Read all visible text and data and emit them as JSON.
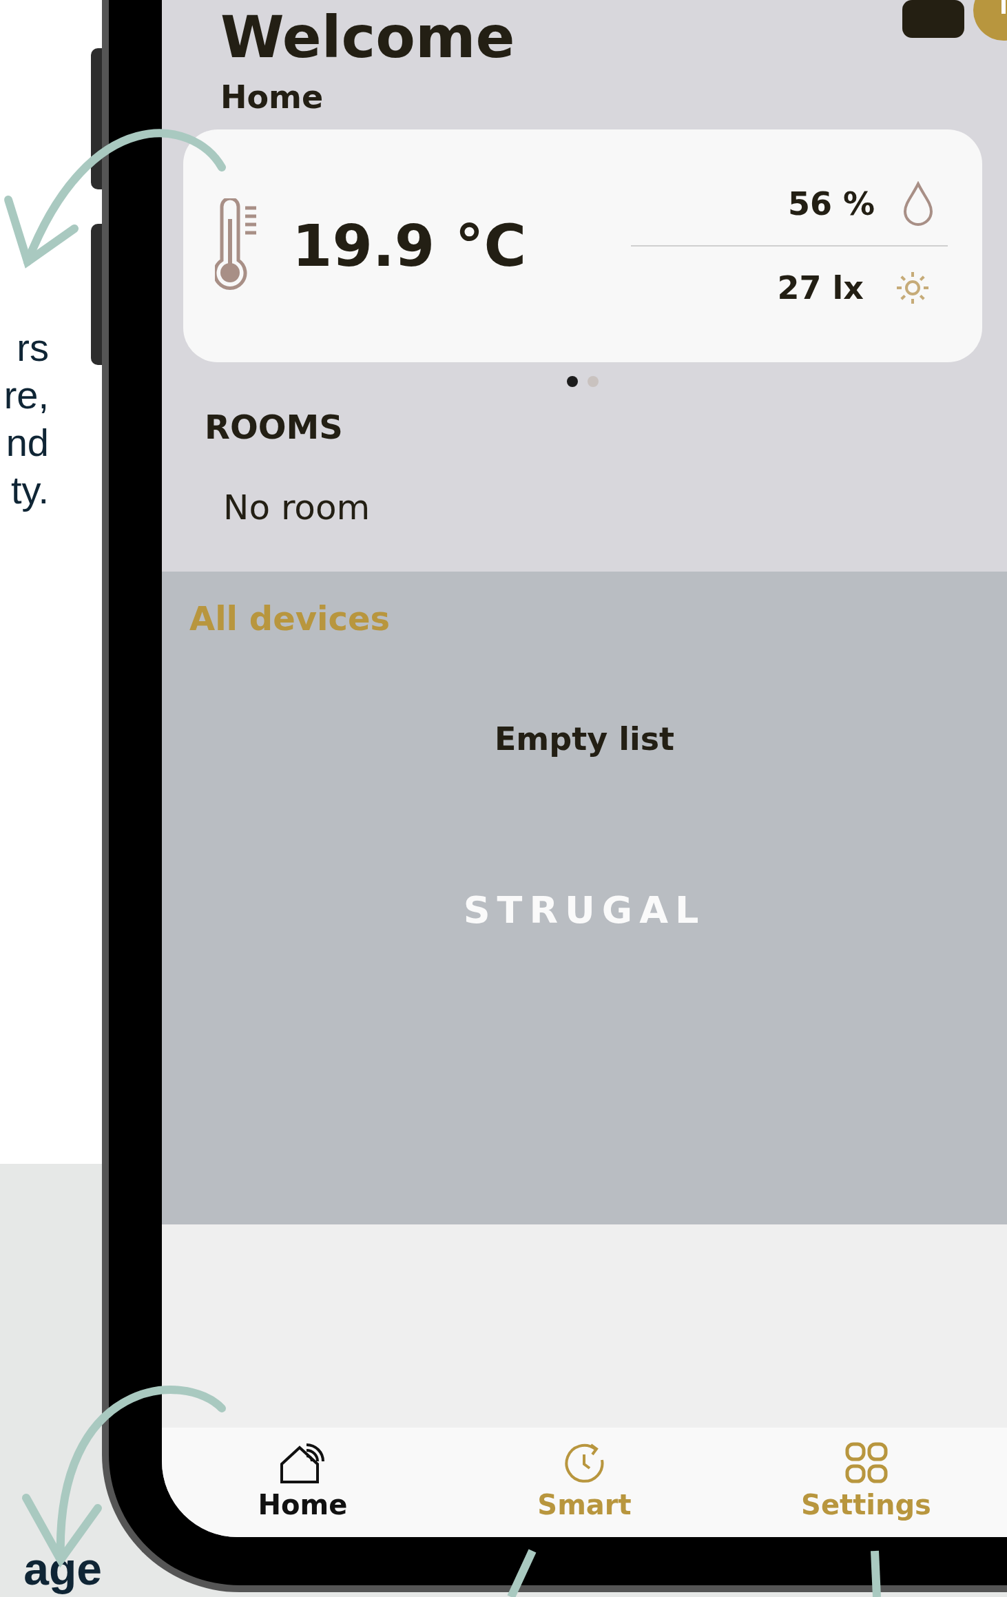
{
  "side_text": [
    "rs",
    "re,",
    "nd",
    "ty."
  ],
  "bottom_caption": "age",
  "header": {
    "title": "Welcome",
    "location": "Home"
  },
  "climate_card": {
    "temperature": "19.9 °C",
    "humidity": "56 %",
    "light": "27 lx"
  },
  "carousel_dots": [
    {
      "selected": true
    },
    {
      "selected": false
    }
  ],
  "rooms": {
    "heading": "ROOMS",
    "empty_text": "No room"
  },
  "devices": {
    "heading": "All devices",
    "empty_text": "Empty list",
    "logo": "STRUGAL"
  },
  "nav": [
    {
      "kind": "home",
      "label": "Home",
      "selected": true
    },
    {
      "kind": "smart",
      "label": "Smart",
      "selected": false
    },
    {
      "kind": "settings",
      "label": "Settings",
      "selected": false
    }
  ]
}
